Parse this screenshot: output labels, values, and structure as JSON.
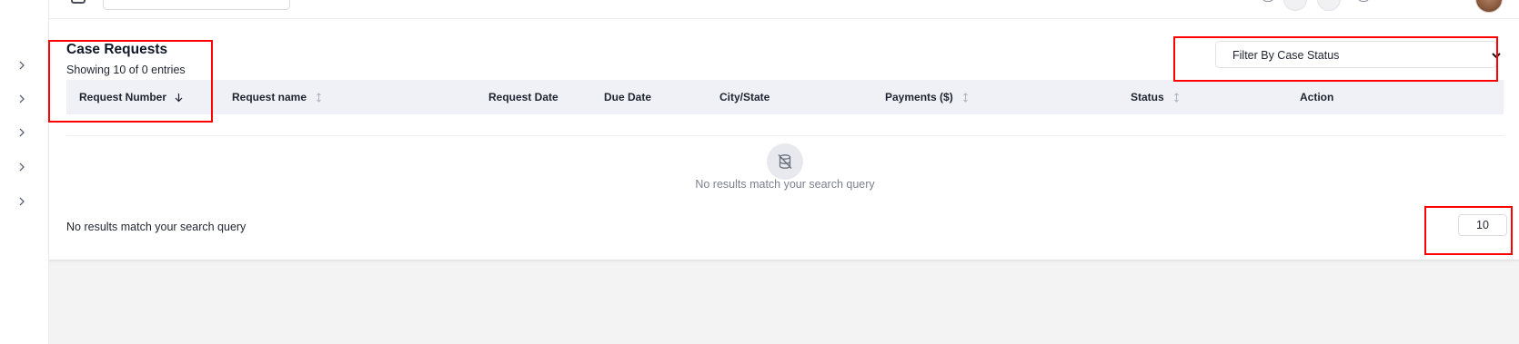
{
  "sidebar": {
    "items": [
      {
        "icon": "chevron-right-icon"
      },
      {
        "icon": "chevron-right-icon"
      },
      {
        "icon": "chevron-right-icon"
      },
      {
        "icon": "chevron-right-icon"
      },
      {
        "icon": "chevron-right-icon"
      }
    ]
  },
  "header": {
    "title": "Case Requests",
    "showing": "Showing 10 of 0 entries"
  },
  "filter": {
    "label": "Filter By Case Status"
  },
  "table": {
    "columns": [
      {
        "label": "Request Number",
        "sort": "desc"
      },
      {
        "label": "Request name",
        "sort": "sortable"
      },
      {
        "label": "Request Date",
        "sort": "none"
      },
      {
        "label": "Due Date",
        "sort": "none"
      },
      {
        "label": "City/State",
        "sort": "none"
      },
      {
        "label": "Payments ($)",
        "sort": "sortable"
      },
      {
        "label": "Status",
        "sort": "sortable"
      },
      {
        "label": "Action",
        "sort": "none"
      }
    ],
    "empty_message": "No results match your search query"
  },
  "footer": {
    "message": "No results match your search query",
    "page_size": "10"
  },
  "colors": {
    "annotation": "#ff0000",
    "header_bg": "#eff1f6"
  }
}
